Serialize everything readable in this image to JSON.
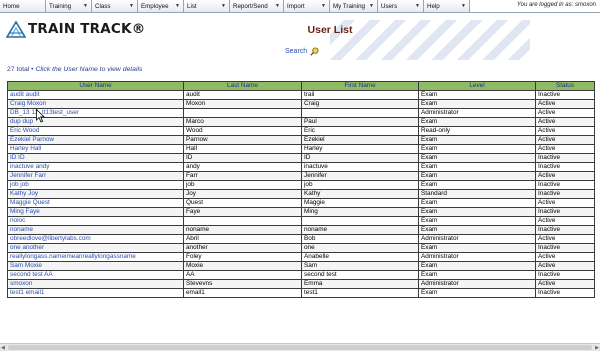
{
  "menu": [
    {
      "label": "Home"
    },
    {
      "label": "Training"
    },
    {
      "label": "Class"
    },
    {
      "label": "Employee"
    },
    {
      "label": "List"
    },
    {
      "label": "Report/Send"
    },
    {
      "label": "Import"
    },
    {
      "label": "My Training"
    },
    {
      "label": "Users"
    },
    {
      "label": "Help"
    }
  ],
  "login_status": "You are logged in as: smoxon",
  "logo": {
    "text": "TRAIN TRACK®"
  },
  "page_title": "User List",
  "search_label": "Search",
  "summary": {
    "count": "27 total",
    "separator": " • ",
    "hint": "Click the User Name to view details"
  },
  "table": {
    "headers": [
      "User Name",
      "Last Name",
      "First Name",
      "Level",
      "Status"
    ],
    "rows": [
      [
        "audit audit",
        "audit",
        "trail",
        "Exam",
        "Inactive"
      ],
      [
        "Craig Moxon",
        "Moxon",
        "Craig",
        "Exam",
        "Active"
      ],
      [
        "DB_13      13_tt13test_user",
        "",
        "",
        "Administrator",
        "Active"
      ],
      [
        "dup dup",
        "Marco",
        "Paul",
        "Exam",
        "Active"
      ],
      [
        "Eric Wood",
        "Wood",
        "Eric",
        "Read-only",
        "Active"
      ],
      [
        "Ezekiel Parnow",
        "Parnow",
        "Ezekiel",
        "Exam",
        "Active"
      ],
      [
        "Harley Hall",
        "Hall",
        "Harley",
        "Exam",
        "Active"
      ],
      [
        "ID ID",
        "ID",
        "ID",
        "Exam",
        "Inactive"
      ],
      [
        "inactuve andy",
        "andy",
        "inactuve",
        "Exam",
        "Inactive"
      ],
      [
        "Jennifer Farr",
        "Farr",
        "Jennifer",
        "Exam",
        "Active"
      ],
      [
        "job job",
        "job",
        "job",
        "Exam",
        "Inactive"
      ],
      [
        "Kathy Joy",
        "Joy",
        "Kathy",
        "Standard",
        "Inactive"
      ],
      [
        "Maggie Quest",
        "Quest",
        "Maggie",
        "Exam",
        "Active"
      ],
      [
        "Ming Faye",
        "Faye",
        "Ming",
        "Exam",
        "Inactive"
      ],
      [
        "noloc",
        "",
        "",
        "Exam",
        "Active"
      ],
      [
        "noname",
        "noname",
        "noname",
        "Exam",
        "Inactive"
      ],
      [
        "obreedlove@libertylabs.com",
        "Abril",
        "Bob",
        "Administrator",
        "Active"
      ],
      [
        "one another",
        "another",
        "one",
        "Exam",
        "Inactive"
      ],
      [
        "reallylongass.nameimeanreallylongassname",
        "Foley",
        "Anabelle",
        "Administrator",
        "Active"
      ],
      [
        "Sam Moxie",
        "Moxie",
        "Sam",
        "Exam",
        "Active"
      ],
      [
        "second test AA",
        "AA",
        "second test",
        "Exam",
        "Inactive"
      ],
      [
        "smoxon",
        "Stevevns",
        "Emma",
        "Administrator",
        "Active"
      ],
      [
        "test1 email1",
        "email1",
        "test1",
        "Exam",
        "Inactive"
      ]
    ]
  },
  "colors": {
    "header_green": "#8fbb64",
    "title_maroon": "#6b1f14",
    "link_blue": "#2a4fb0"
  }
}
